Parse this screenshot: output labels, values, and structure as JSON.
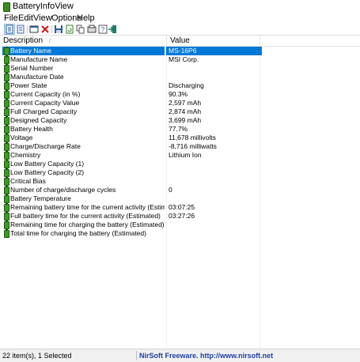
{
  "window": {
    "title": "BatteryInfoView"
  },
  "menu": [
    "File",
    "Edit",
    "View",
    "Options",
    "Help"
  ],
  "toolbar": {
    "icons": [
      "properties-list-icon",
      "html-report-icon",
      "advanced-options-icon",
      "delete-icon",
      "save-icon",
      "refresh-icon",
      "copy-icon",
      "properties-icon",
      "about-icon",
      "exit-icon"
    ]
  },
  "columns": {
    "description": "Description",
    "value": "Value"
  },
  "rows": [
    {
      "description": "Battery Name",
      "value": "MS-16P6"
    },
    {
      "description": "Manufacture Name",
      "value": "MSI Corp."
    },
    {
      "description": "Serial Number",
      "value": ""
    },
    {
      "description": "Manufacture Date",
      "value": ""
    },
    {
      "description": "Power State",
      "value": "Discharging"
    },
    {
      "description": "Current Capacity (in %)",
      "value": "90.3%"
    },
    {
      "description": "Current Capacity Value",
      "value": "2,597 mAh"
    },
    {
      "description": "Full Charged Capacity",
      "value": "2,874 mAh"
    },
    {
      "description": "Designed Capacity",
      "value": "3,699 mAh"
    },
    {
      "description": "Battery Health",
      "value": "77.7%"
    },
    {
      "description": "Voltage",
      "value": "11,678 millivolts"
    },
    {
      "description": "Charge/Discharge Rate",
      "value": "-8,716 milliwatts"
    },
    {
      "description": "Chemistry",
      "value": "Lithium Ion"
    },
    {
      "description": "Low Battery Capacity (1)",
      "value": ""
    },
    {
      "description": "Low Battery Capacity (2)",
      "value": ""
    },
    {
      "description": "Critical Bias",
      "value": ""
    },
    {
      "description": "Number of charge/discharge cycles",
      "value": "0"
    },
    {
      "description": "Battery Temperature",
      "value": ""
    },
    {
      "description": "Remaining battery time for the current activity (Estimated)",
      "value": "03:07:25"
    },
    {
      "description": "Full battery time for the current activity (Estimated)",
      "value": "03:27:26"
    },
    {
      "description": "Remaining time for charging the battery (Estimated)",
      "value": ""
    },
    {
      "description": "Total  time for charging the battery (Estimated)",
      "value": ""
    }
  ],
  "status": {
    "count": "22 item(s), 1 Selected",
    "link": "NirSoft Freeware.  http://www.nirsoft.net"
  },
  "colors": {
    "selection": "#0078d7",
    "battery": "#3c9b22",
    "link": "#1f3fa3"
  }
}
